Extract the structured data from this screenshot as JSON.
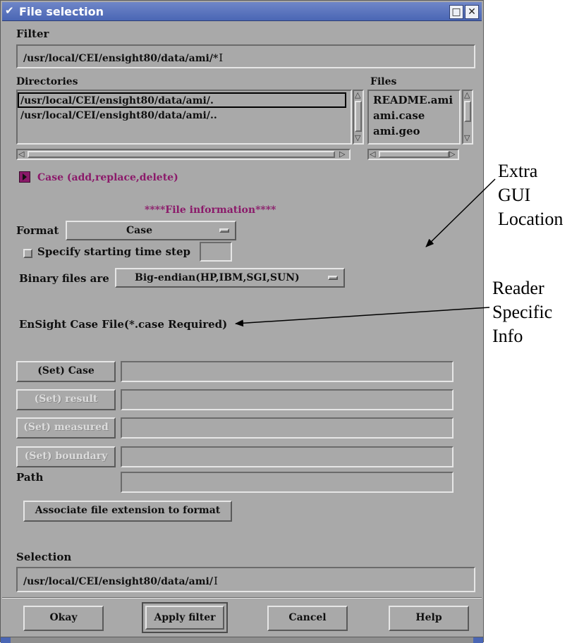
{
  "window": {
    "title": "File selection",
    "menu_icon": "chevron-down-icon",
    "minimize_icon": "maximize-icon",
    "close_icon": "close-icon"
  },
  "filter": {
    "label": "Filter",
    "value": "/usr/local/CEI/ensight80/data/ami/*"
  },
  "directories": {
    "label": "Directories",
    "items": [
      "/usr/local/CEI/ensight80/data/ami/.",
      "/usr/local/CEI/ensight80/data/ami/.."
    ]
  },
  "files": {
    "label": "Files",
    "items": [
      "README.ami",
      "ami.case",
      "ami.geo"
    ]
  },
  "case_toggle": {
    "label": "Case (add,replace,delete)",
    "icon": "triangle-right-icon"
  },
  "file_info": {
    "heading": "****File information****",
    "format_label": "Format",
    "format_value": "Case",
    "specify_time_label": "Specify starting time step",
    "specify_time_value": "",
    "binary_label": "Binary files are",
    "binary_value": "Big-endian(HP,IBM,SGI,SUN)",
    "reader_info": "EnSight Case File(*.case Required)"
  },
  "set_buttons": [
    {
      "label": "(Set) Case",
      "value": "",
      "enabled": true
    },
    {
      "label": "(Set) result",
      "value": "",
      "enabled": false
    },
    {
      "label": "(Set) measured",
      "value": "",
      "enabled": false
    },
    {
      "label": "(Set) boundary",
      "value": "",
      "enabled": false
    }
  ],
  "path": {
    "label": "Path",
    "value": ""
  },
  "associate_button": "Associate file extension to format",
  "selection": {
    "label": "Selection",
    "value": "/usr/local/CEI/ensight80/data/ami/"
  },
  "buttons": {
    "okay": "Okay",
    "apply": "Apply filter",
    "cancel": "Cancel",
    "help": "Help"
  },
  "annotations": {
    "extra_gui": [
      "Extra",
      "GUI",
      "Location"
    ],
    "reader_specific": [
      "Reader",
      "Specific",
      "Info"
    ]
  }
}
